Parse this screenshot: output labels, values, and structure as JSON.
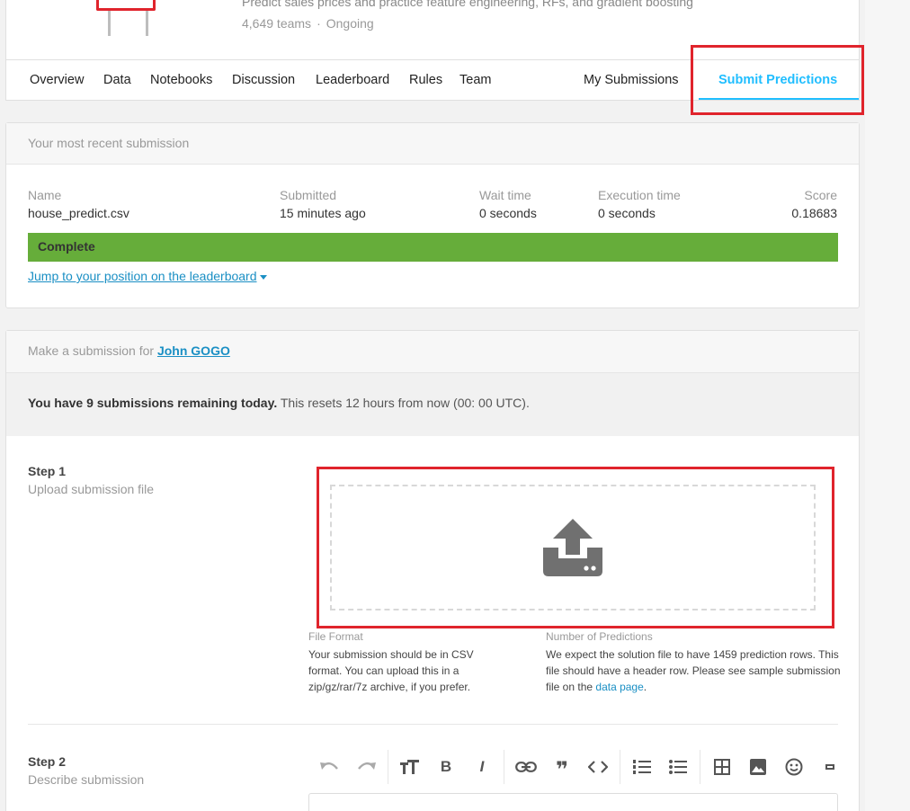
{
  "competition": {
    "description": "Predict sales prices and practice feature engineering, RFs, and gradient boosting",
    "teams": "4,649 teams",
    "status": "Ongoing"
  },
  "nav": {
    "tabs": [
      "Overview",
      "Data",
      "Notebooks",
      "Discussion",
      "Leaderboard",
      "Rules",
      "Team"
    ],
    "my_submissions": "My Submissions",
    "submit_predictions": "Submit Predictions"
  },
  "recent": {
    "header": "Your most recent submission",
    "name_label": "Name",
    "name_value": "house_predict.csv",
    "submitted_label": "Submitted",
    "submitted_value": "15 minutes ago",
    "wait_label": "Wait time",
    "wait_value": "0 seconds",
    "exec_label": "Execution time",
    "exec_value": "0 seconds",
    "score_label": "Score",
    "score_value": "0.18683",
    "status": "Complete",
    "jump_link": "Jump to your position on the leaderboard"
  },
  "submission": {
    "header_prefix": "Make a submission for",
    "user": "John GOGO",
    "remaining_bold": "You have 9 submissions remaining today.",
    "remaining_rest": " This resets 12 hours from now (00: 00 UTC).",
    "step1_title": "Step 1",
    "step1_sub": "Upload submission file",
    "file_format_title": "File Format",
    "file_format_text": "Your submission should be in CSV format. You can upload this in a zip/gz/rar/7z archive, if you prefer.",
    "num_predictions_title": "Number of Predictions",
    "num_predictions_text": "We expect the solution file to have 1459 prediction rows. This file should have a header row. Please see sample submission file on the",
    "data_page_link": "data page",
    "period": ".",
    "step2_title": "Step 2",
    "step2_sub": "Describe submission"
  },
  "colors": {
    "accent": "#20beff",
    "complete": "#66ad3a",
    "highlight": "#e0242c",
    "link": "#1a8fc4"
  }
}
